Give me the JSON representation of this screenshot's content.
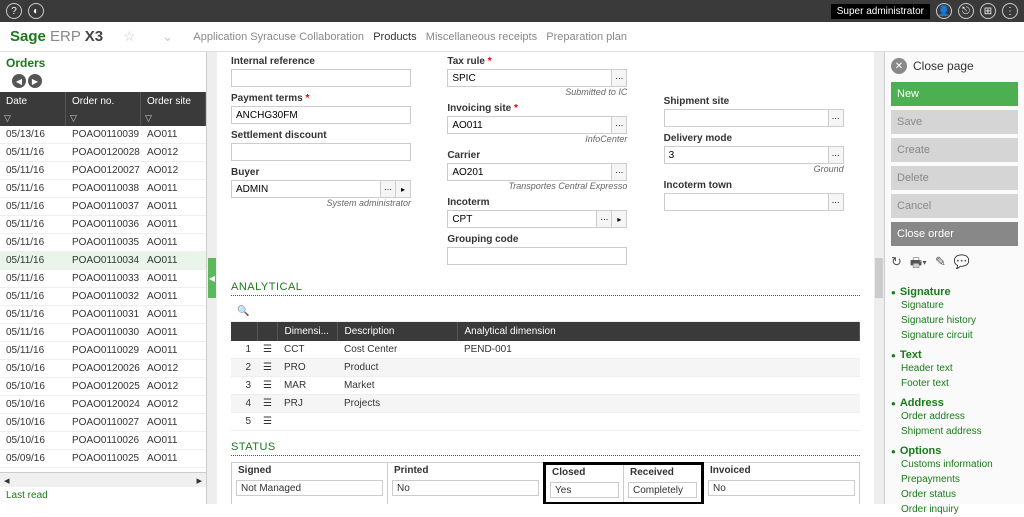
{
  "topbar": {
    "super_admin": "Super administrator"
  },
  "logo": {
    "sage": "Sage",
    "erp": " ERP ",
    "x3": "X3"
  },
  "breadcrumb": {
    "app": "Application Syracuse Collaboration",
    "products": "Products",
    "misc": "Miscellaneous receipts",
    "plan": "Preparation plan"
  },
  "left": {
    "title": "Orders",
    "headers": {
      "date": "Date",
      "order": "Order no.",
      "site": "Order site"
    },
    "rows": [
      {
        "date": "05/13/16",
        "order": "POAO0110039",
        "site": "AO011"
      },
      {
        "date": "05/11/16",
        "order": "POAO0120028",
        "site": "AO012"
      },
      {
        "date": "05/11/16",
        "order": "POAO0120027",
        "site": "AO012"
      },
      {
        "date": "05/11/16",
        "order": "POAO0110038",
        "site": "AO011"
      },
      {
        "date": "05/11/16",
        "order": "POAO0110037",
        "site": "AO011"
      },
      {
        "date": "05/11/16",
        "order": "POAO0110036",
        "site": "AO011"
      },
      {
        "date": "05/11/16",
        "order": "POAO0110035",
        "site": "AO011"
      },
      {
        "date": "05/11/16",
        "order": "POAO0110034",
        "site": "AO011"
      },
      {
        "date": "05/11/16",
        "order": "POAO0110033",
        "site": "AO011"
      },
      {
        "date": "05/11/16",
        "order": "POAO0110032",
        "site": "AO011"
      },
      {
        "date": "05/11/16",
        "order": "POAO0110031",
        "site": "AO011"
      },
      {
        "date": "05/11/16",
        "order": "POAO0110030",
        "site": "AO011"
      },
      {
        "date": "05/11/16",
        "order": "POAO0110029",
        "site": "AO011"
      },
      {
        "date": "05/10/16",
        "order": "POAO0120026",
        "site": "AO012"
      },
      {
        "date": "05/10/16",
        "order": "POAO0120025",
        "site": "AO012"
      },
      {
        "date": "05/10/16",
        "order": "POAO0120024",
        "site": "AO012"
      },
      {
        "date": "05/10/16",
        "order": "POAO0110027",
        "site": "AO011"
      },
      {
        "date": "05/10/16",
        "order": "POAO0110026",
        "site": "AO011"
      },
      {
        "date": "05/09/16",
        "order": "POAO0110025",
        "site": "AO011"
      }
    ],
    "last_read": "Last read"
  },
  "form": {
    "internal_ref_label": "Internal reference",
    "internal_ref": "",
    "payment_terms_label": "Payment terms",
    "payment_terms": "ANCHG30FM",
    "settlement_label": "Settlement discount",
    "settlement": "",
    "buyer_label": "Buyer",
    "buyer": "ADMIN",
    "buyer_sub": "System administrator",
    "tax_rule_label": "Tax rule",
    "tax_rule": "SPIC",
    "tax_rule_sub": "Submitted to IC",
    "invoicing_label": "Invoicing site",
    "invoicing": "AO011",
    "invoicing_sub": "InfoCenter",
    "carrier_label": "Carrier",
    "carrier": "AO201",
    "carrier_sub": "Transportes Central Expresso",
    "incoterm_label": "Incoterm",
    "incoterm": "CPT",
    "grouping_label": "Grouping code",
    "grouping": "",
    "shipment_label": "Shipment site",
    "shipment": "",
    "delivery_label": "Delivery mode",
    "delivery": "3",
    "delivery_sub": "Ground",
    "incoterm_town_label": "Incoterm town",
    "incoterm_town": ""
  },
  "analytical": {
    "title": "ANALYTICAL",
    "headers": {
      "dim": "Dimensi...",
      "desc": "Description",
      "adim": "Analytical dimension"
    },
    "rows": [
      {
        "n": "1",
        "dim": "CCT",
        "desc": "Cost Center",
        "adim": "PEND-001"
      },
      {
        "n": "2",
        "dim": "PRO",
        "desc": "Product",
        "adim": ""
      },
      {
        "n": "3",
        "dim": "MAR",
        "desc": "Market",
        "adim": ""
      },
      {
        "n": "4",
        "dim": "PRJ",
        "desc": "Projects",
        "adim": ""
      },
      {
        "n": "5",
        "dim": "",
        "desc": "",
        "adim": ""
      }
    ]
  },
  "status": {
    "title": "STATUS",
    "signed_l": "Signed",
    "signed_v": "Not Managed",
    "printed_l": "Printed",
    "printed_v": "No",
    "closed_l": "Closed",
    "closed_v": "Yes",
    "received_l": "Received",
    "received_v": "Completely",
    "invoiced_l": "Invoiced",
    "invoiced_v": "No"
  },
  "right": {
    "close_page": "Close page",
    "new": "New",
    "save": "Save",
    "create": "Create",
    "delete": "Delete",
    "cancel": "Cancel",
    "close_order": "Close order",
    "signature_h": "Signature",
    "sig_links": [
      "Signature",
      "Signature history",
      "Signature circuit"
    ],
    "text_h": "Text",
    "text_links": [
      "Header text",
      "Footer text"
    ],
    "address_h": "Address",
    "addr_links": [
      "Order address",
      "Shipment address"
    ],
    "options_h": "Options",
    "opt_links": [
      "Customs information",
      "Prepayments",
      "Order status",
      "Order inquiry"
    ]
  }
}
